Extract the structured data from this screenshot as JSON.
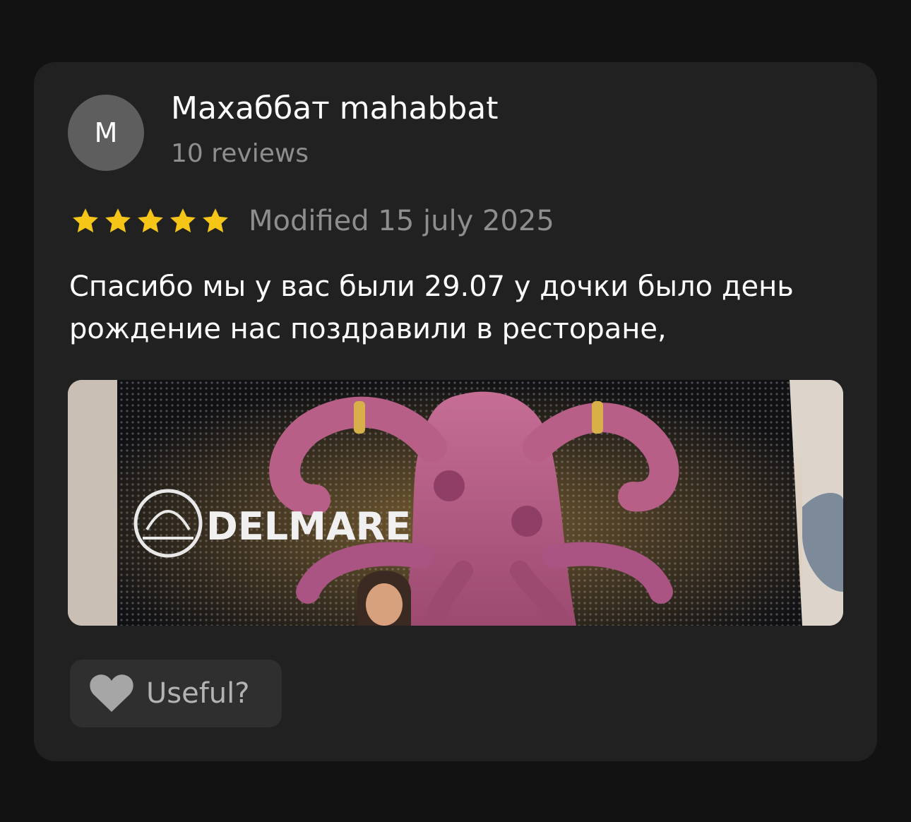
{
  "review": {
    "author": {
      "initial": "М",
      "name": "Махаббат mahabbat",
      "reviews_count": "10 reviews"
    },
    "rating": {
      "value": 5,
      "max": 5,
      "color": "#F5C518"
    },
    "date": "Modified 15 july 2025",
    "text": "Спасибо мы у вас были 29.07 у дочки было день рождение нас поздравили в ресторане,",
    "photo": {
      "sign_text": "DELMARE"
    },
    "useful_label": "Useful?"
  },
  "icons": {
    "star": "star-icon",
    "heart": "heart-icon"
  }
}
